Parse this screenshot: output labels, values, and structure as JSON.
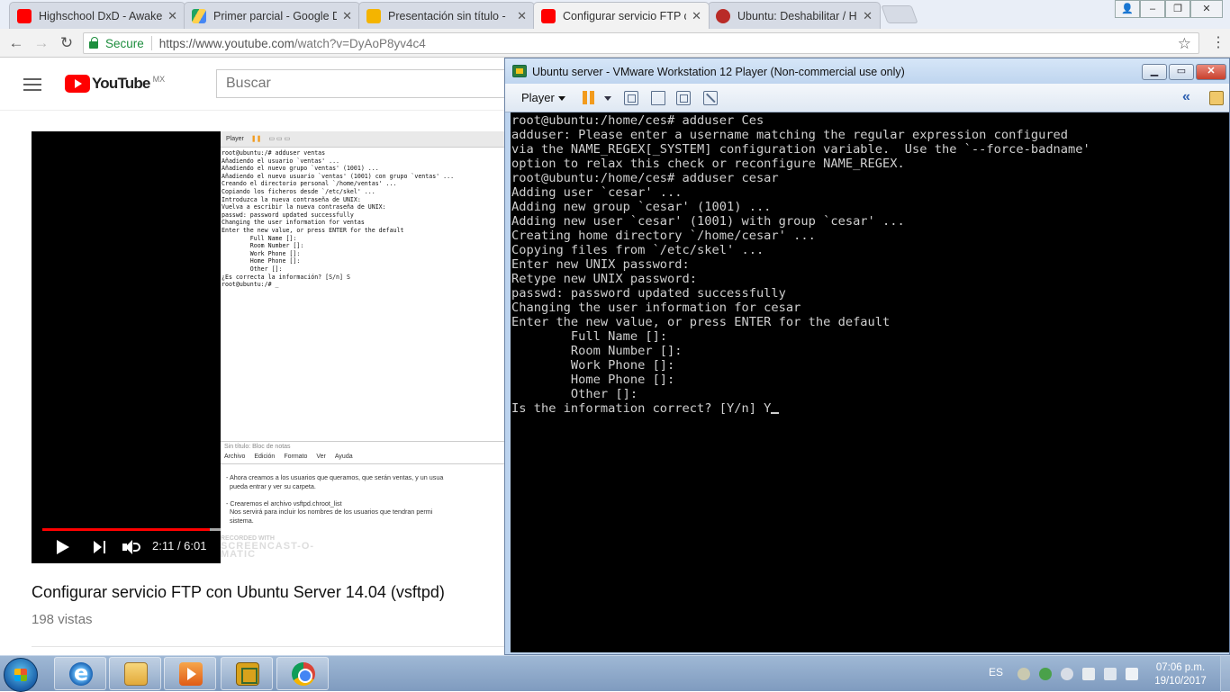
{
  "browser": {
    "tabs": [
      {
        "title": "Highschool DxD - Awake",
        "favicon": "youtube-icon",
        "color": "#ff0000"
      },
      {
        "title": "Primer parcial - Google D",
        "favicon": "google-drive-icon",
        "color": "#1fa463"
      },
      {
        "title": "Presentación sin título -",
        "favicon": "google-slides-icon",
        "color": "#f4b400"
      },
      {
        "title": "Configurar servicio FTP c",
        "favicon": "youtube-icon",
        "color": "#ff0000"
      },
      {
        "title": "Ubuntu: Deshabilitar / Ha",
        "favicon": "quora-icon",
        "color": "#b92b27"
      }
    ],
    "active_tab_index": 3,
    "secure_label": "Secure",
    "url_host": "https://www.youtube.com",
    "url_path": "/watch?v=DyAoP8yv4c4"
  },
  "youtube": {
    "logo_text": "YouTube",
    "region": "MX",
    "search_placeholder": "Buscar",
    "video": {
      "title": "Configurar servicio FTP con Ubuntu Server 14.04 (vsftpd)",
      "views": "198 vistas",
      "time": "2:11 / 6:01",
      "progress_fraction": 0.363,
      "buffered_fraction": 0.98
    },
    "frame": {
      "toolbar_label": "Player",
      "terminal_lines": [
        "root@ubuntu:/# adduser ventas",
        "Añadiendo el usuario `ventas' ...",
        "Añadiendo el nuevo grupo `ventas' (1001) ...",
        "Añadiendo el nuevo usuario `ventas' (1001) con grupo `ventas' ...",
        "Creando el directorio personal `/home/ventas' ...",
        "Copiando los ficheros desde `/etc/skel' ...",
        "Introduzca la nueva contraseña de UNIX:",
        "Vuelva a escribir la nueva contraseña de UNIX:",
        "passwd: password updated successfully",
        "Changing the user information for ventas",
        "Enter the new value, or press ENTER for the default",
        "        Full Name []:",
        "        Room Number []:",
        "        Work Phone []:",
        "        Home Phone []:",
        "        Other []:",
        "¿Es correcta la información? [S/n] S",
        "root@ubuntu:/# _"
      ],
      "notepad_title": "Sin título: Bloc de notas",
      "notepad_menu": [
        "Archivo",
        "Edición",
        "Formato",
        "Ver",
        "Ayuda"
      ],
      "notepad_text": "- Ahora creamos a los usuarios que queramos, que serán ventas, y un usua\n  pueda entrar y ver su carpeta.\n\n- Crearemos el archivo vsftpd.chroot_list\n  Nos servirá para incluir los nombres de los usuarios que tendran permi\n  sistema.",
      "watermark_small": "RECORDED WITH",
      "watermark_big": "SCREENCAST-O-MATIC"
    }
  },
  "vmware": {
    "title": "Ubuntu server - VMware Workstation 12 Player (Non-commercial use only)",
    "player_menu": "Player",
    "console_lines": [
      "root@ubuntu:/home/ces# adduser Ces",
      "adduser: Please enter a username matching the regular expression configured",
      "via the NAME_REGEX[_SYSTEM] configuration variable.  Use the `--force-badname'",
      "option to relax this check or reconfigure NAME_REGEX.",
      "root@ubuntu:/home/ces# adduser cesar",
      "Adding user `cesar' ...",
      "Adding new group `cesar' (1001) ...",
      "Adding new user `cesar' (1001) with group `cesar' ...",
      "Creating home directory `/home/cesar' ...",
      "Copying files from `/etc/skel' ...",
      "Enter new UNIX password:",
      "Retype new UNIX password:",
      "passwd: password updated successfully",
      "Changing the user information for cesar",
      "Enter the new value, or press ENTER for the default",
      "        Full Name []:",
      "        Room Number []:",
      "        Work Phone []:",
      "        Home Phone []:",
      "        Other []:"
    ],
    "console_prompt": "Is the information correct? [Y/n] Y"
  },
  "taskbar": {
    "language": "ES",
    "time": "07:06 p.m.",
    "date": "19/10/2017"
  }
}
